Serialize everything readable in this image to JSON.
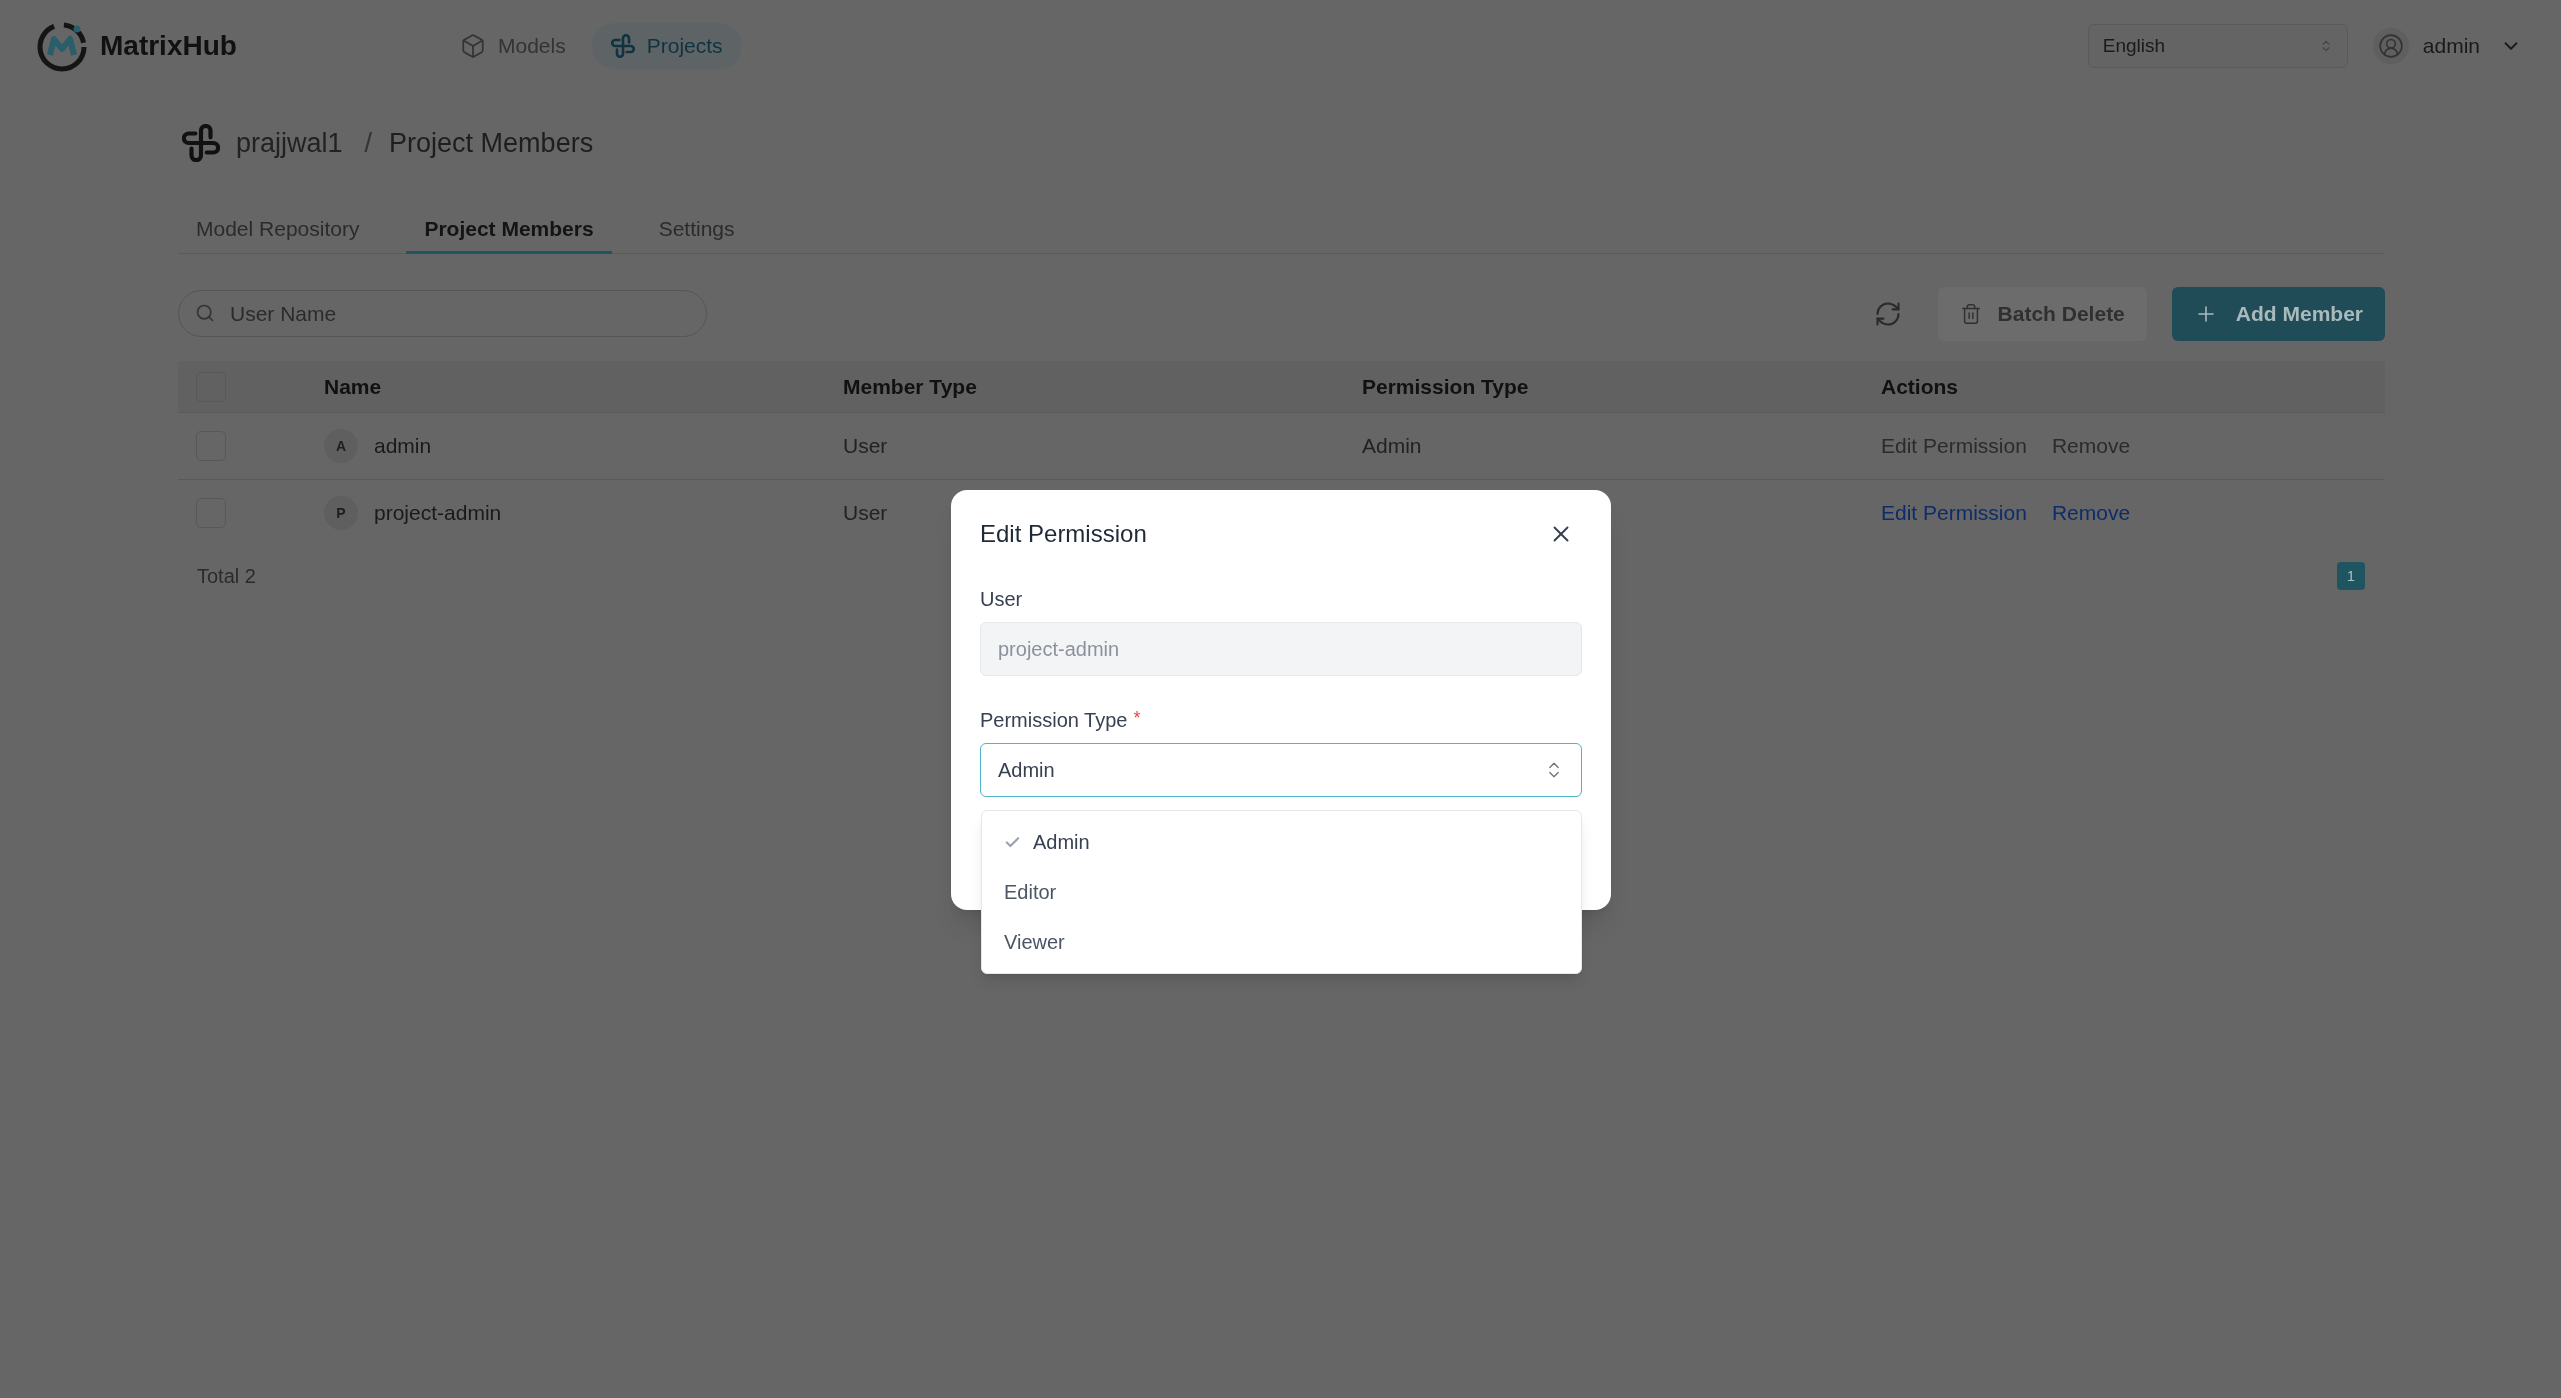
{
  "header": {
    "brand": "MatrixHub",
    "nav": [
      {
        "label": "Models",
        "selected": false
      },
      {
        "label": "Projects",
        "selected": true
      }
    ],
    "language": {
      "value": "English"
    },
    "user": {
      "name": "admin"
    }
  },
  "breadcrumb": {
    "project": "prajjwal1",
    "separator": "/",
    "page": "Project Members"
  },
  "tabs": [
    {
      "label": "Model Repository",
      "selected": false
    },
    {
      "label": "Project Members",
      "selected": true
    },
    {
      "label": "Settings",
      "selected": false
    }
  ],
  "toolbar": {
    "search": {
      "placeholder": "User Name"
    },
    "batch_delete": {
      "label": "Batch Delete",
      "disabled": true
    },
    "add_member": {
      "label": "Add Member"
    }
  },
  "table": {
    "select_all": {
      "checked": false
    },
    "columns": [
      "Name",
      "Member Type",
      "Permission Type",
      "Actions"
    ],
    "rows": [
      {
        "checked": false,
        "initial": "A",
        "name": "admin",
        "member_type": "User",
        "permission_type": "Admin",
        "actions": [
          {
            "label": "Edit Permission",
            "disabled": true
          },
          {
            "label": "Remove",
            "disabled": true
          }
        ]
      },
      {
        "checked": false,
        "initial": "P",
        "name": "project-admin",
        "member_type": "User",
        "actions": [
          {
            "label": "Edit Permission",
            "disabled": false
          },
          {
            "label": "Remove",
            "disabled": false
          }
        ]
      }
    ]
  },
  "footer": {
    "total": "Total 2",
    "pages": [
      {
        "label": "1",
        "selected": true
      }
    ]
  },
  "dialog": {
    "title": "Edit Permission",
    "fields": [
      {
        "kind": "text",
        "label": "User",
        "value": "project-admin",
        "disabled": true
      },
      {
        "kind": "select",
        "label": "Permission Type",
        "required_mark": "*",
        "value": "Admin",
        "focused": true,
        "expanded": true,
        "options": [
          {
            "label": "Admin",
            "selected": true
          },
          {
            "label": "Editor",
            "selected": false
          },
          {
            "label": "Viewer",
            "selected": false
          }
        ]
      }
    ]
  }
}
